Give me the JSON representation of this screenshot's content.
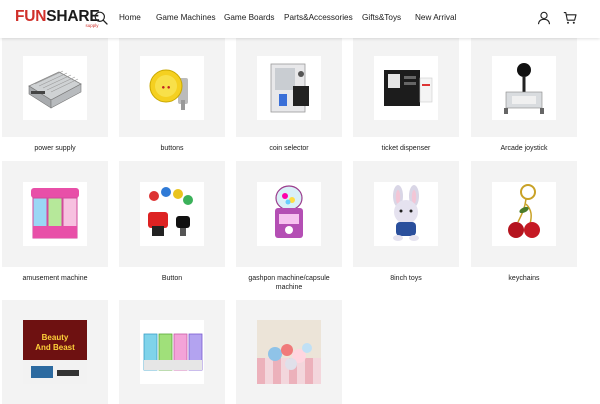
{
  "brand": {
    "name_part1": "FUN",
    "name_part2": "SHARE",
    "tagline": "supply"
  },
  "nav": [
    "Home",
    "Game Machines",
    "Game Boards",
    "Parts&Accessories",
    "Gifts&Toys",
    "New Arrival"
  ],
  "header_icons": {
    "search": "search-icon",
    "account": "user-icon",
    "cart": "cart-icon"
  },
  "products": [
    {
      "name": "power supply",
      "icon": "power-supply-photo"
    },
    {
      "name": "buttons",
      "icon": "buttons-photo"
    },
    {
      "name": "coin selector",
      "icon": "coin-selector-photo"
    },
    {
      "name": "ticket dispenser",
      "icon": "ticket-dispenser-photo"
    },
    {
      "name": "Arcade joystick",
      "icon": "joystick-photo"
    },
    {
      "name": "amusement machine",
      "icon": "amusement-machine-photo"
    },
    {
      "name": "Button",
      "icon": "button-photo"
    },
    {
      "name": "gashpon machine/capsule machine",
      "icon": "gashapon-photo"
    },
    {
      "name": "8inch toys",
      "icon": "bunny-toy-photo"
    },
    {
      "name": "keychains",
      "icon": "keychain-photo"
    },
    {
      "name": "",
      "icon": "arcade-game-photo",
      "photo_text": [
        "Beauty",
        "And Beast"
      ]
    },
    {
      "name": "",
      "icon": "claw-machines-photo"
    },
    {
      "name": "",
      "icon": "capsule-balls-photo"
    }
  ],
  "colors": {
    "brand_red": "#d0302a",
    "tile_bg": "#f3f3f3"
  }
}
